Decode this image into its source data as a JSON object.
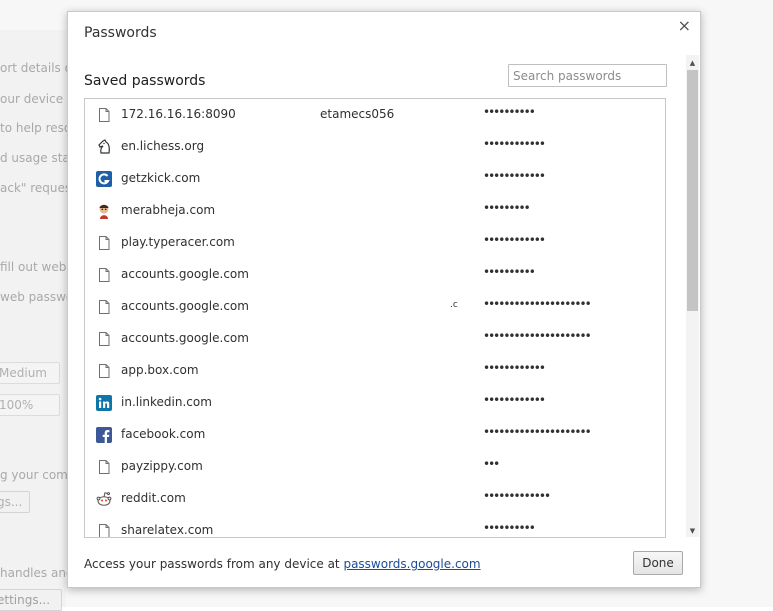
{
  "background": {
    "lines": [
      {
        "text": "ort details of"
      },
      {
        "text": "our device fro"
      },
      {
        "text": "to help resol"
      },
      {
        "text": "d usage stati"
      },
      {
        "text": "ack\" request"
      },
      {
        "text": "fill out web fo"
      },
      {
        "text": "web passwo"
      },
      {
        "text": "g your comp"
      },
      {
        "text": "handles and c"
      }
    ],
    "select_font_size": "Medium",
    "select_zoom": "100%",
    "btn_customize": "gs...",
    "btn_settings": "ettings..."
  },
  "dialog": {
    "title": "Passwords",
    "close_glyph": "×",
    "section_title": "Saved passwords",
    "search_placeholder": "Search passwords",
    "rows": [
      {
        "site": "172.16.16.16:8090",
        "user": "etamecs056",
        "password": "••••••••••",
        "icon": "generic-file-icon"
      },
      {
        "site": "en.lichess.org",
        "user": "",
        "password": "••••••••••••",
        "icon": "lichess-icon"
      },
      {
        "site": "getzkick.com",
        "user": "",
        "password": "••••••••••••",
        "icon": "getzkick-icon"
      },
      {
        "site": "merabheja.com",
        "user": "",
        "password": "•••••••••",
        "icon": "merabheja-avatar-icon"
      },
      {
        "site": "play.typeracer.com",
        "user": "",
        "password": "••••••••••••",
        "icon": "generic-file-icon"
      },
      {
        "site": "accounts.google.com",
        "user": "",
        "password": "••••••••••",
        "icon": "generic-file-icon"
      },
      {
        "site": "accounts.google.com",
        "user": ".c",
        "password": "•••••••••••••••••••••",
        "icon": "generic-file-icon"
      },
      {
        "site": "accounts.google.com",
        "user": "",
        "password": "•••••••••••••••••••••",
        "icon": "generic-file-icon"
      },
      {
        "site": "app.box.com",
        "user": "",
        "password": "••••••••••••",
        "icon": "generic-file-icon"
      },
      {
        "site": "in.linkedin.com",
        "user": "",
        "password": "••••••••••••",
        "icon": "linkedin-icon"
      },
      {
        "site": "facebook.com",
        "user": "",
        "password": "•••••••••••••••••••••",
        "icon": "facebook-icon"
      },
      {
        "site": "payzippy.com",
        "user": "",
        "password": "•••",
        "icon": "generic-file-icon"
      },
      {
        "site": "reddit.com",
        "user": "",
        "password": "•••••••••••••",
        "icon": "reddit-icon"
      },
      {
        "site": "sharelatex.com",
        "user": "",
        "password": "••••••••••",
        "icon": "generic-file-icon"
      }
    ],
    "footer_text": "Access your passwords from any device at ",
    "footer_link": "passwords.google.com",
    "done_label": "Done",
    "scroll_up_glyph": "▲",
    "scroll_down_glyph": "▼"
  },
  "colors": {
    "link": "#1a4d99",
    "linkedin": "#0e76a8",
    "facebook": "#3b5998",
    "getzkick": "#1f5fa8"
  }
}
